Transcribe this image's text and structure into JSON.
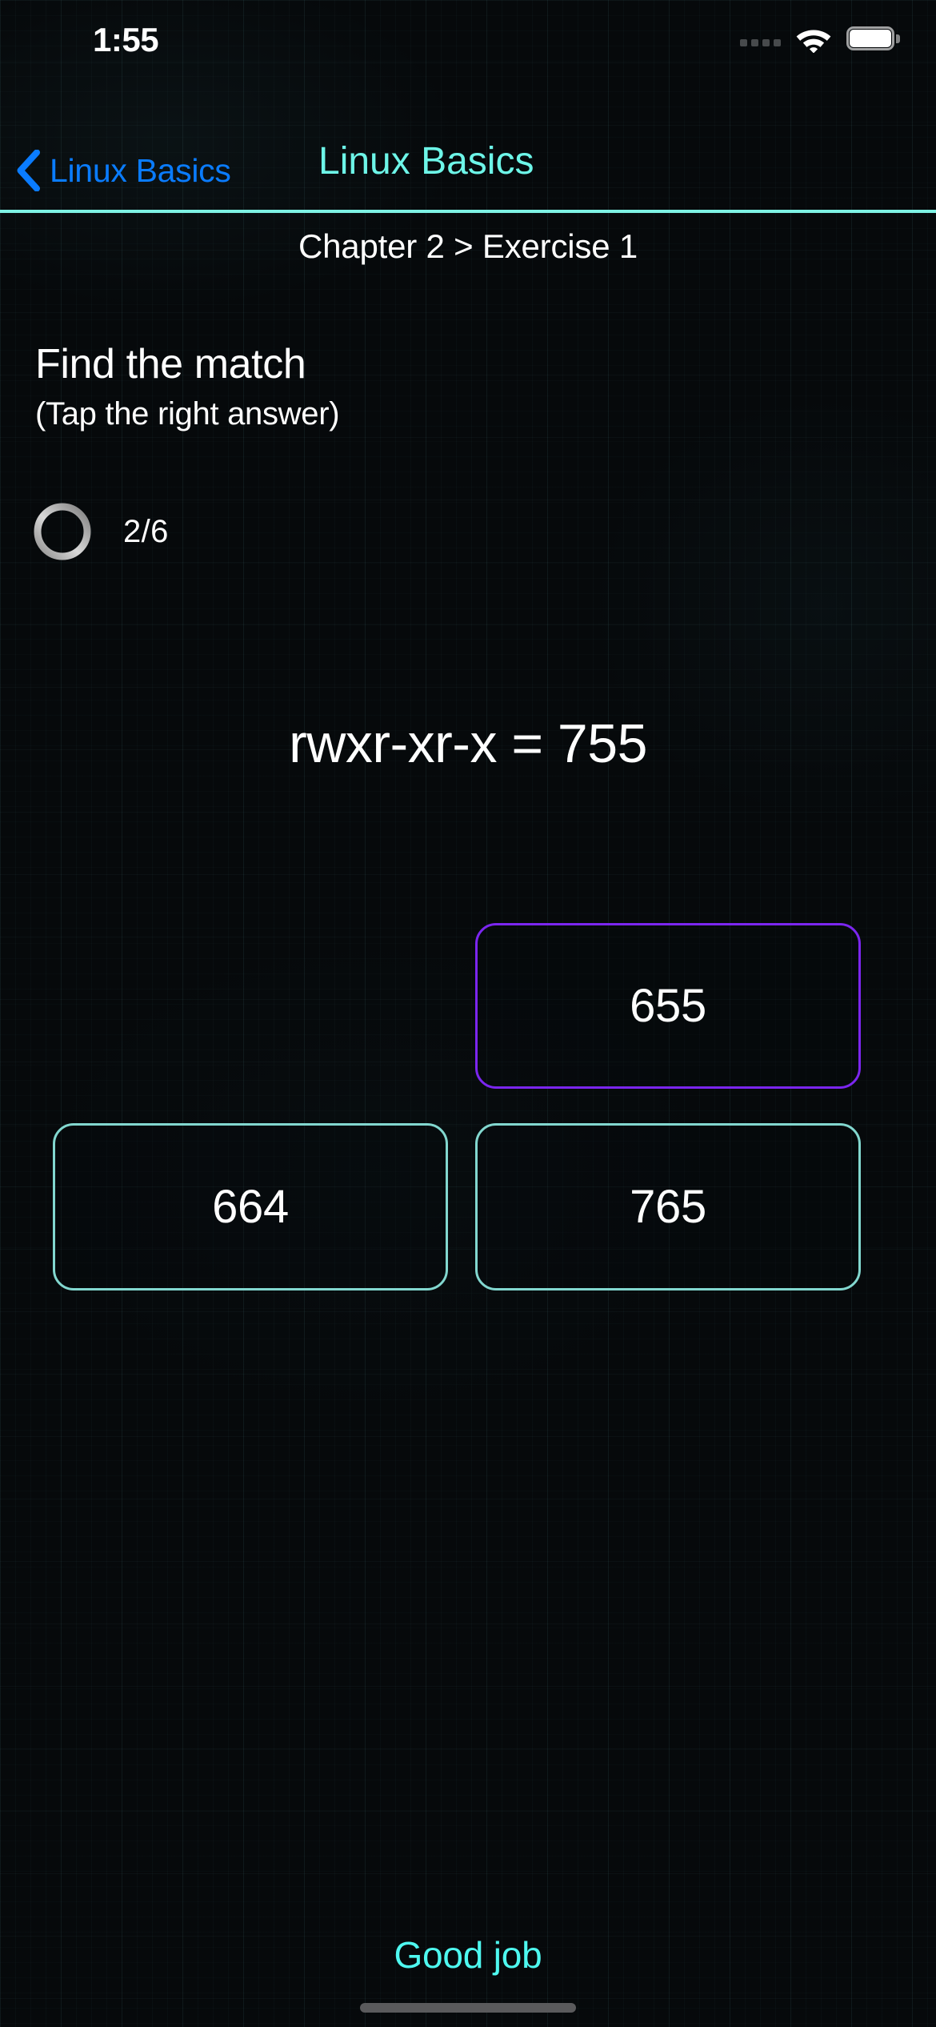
{
  "status_bar": {
    "time": "1:55",
    "cellular_icon": "cellular-dots-icon",
    "cellular_bars": 4,
    "wifi_icon": "wifi-icon",
    "battery_icon": "battery-full-icon",
    "battery_level_percent": 100
  },
  "nav_bar": {
    "back_icon": "chevron-left-icon",
    "back_label": "Linux Basics",
    "title": "Linux Basics",
    "back_color": "#0a7cff",
    "title_color": "#6df5e8",
    "separator_color": "#7ef2e4"
  },
  "breadcrumb": {
    "text": "Chapter 2 > Exercise 1",
    "chapter": "Chapter 2",
    "exercise": "Exercise 1"
  },
  "prompt": {
    "title": "Find the match",
    "subtitle": "(Tap the right answer)"
  },
  "progress": {
    "icon": "progress-ring-icon",
    "label": "2/6",
    "current": 2,
    "total": 6,
    "track_color": "#6e6e6e",
    "arc_color": "#d2d2d2"
  },
  "question": {
    "text": "rwxr-xr-x = 755",
    "permission_string": "rwxr-xr-x",
    "octal_value": "755"
  },
  "answers": [
    {
      "label": "655",
      "state": "selected",
      "border_color": "#7b26ef"
    },
    {
      "label": "664",
      "state": "default",
      "border_color": "#82d7cf"
    },
    {
      "label": "765",
      "state": "default",
      "border_color": "#82d7cf"
    }
  ],
  "footer": {
    "feedback": "Good job",
    "feedback_color": "#4ef8f0",
    "home_indicator": "home-indicator"
  },
  "theme": {
    "background": "#06090b",
    "accent_teal": "#7ef2e4",
    "accent_purple": "#7b26ef",
    "accent_blue": "#0a7cff",
    "text_primary": "#ffffff"
  }
}
